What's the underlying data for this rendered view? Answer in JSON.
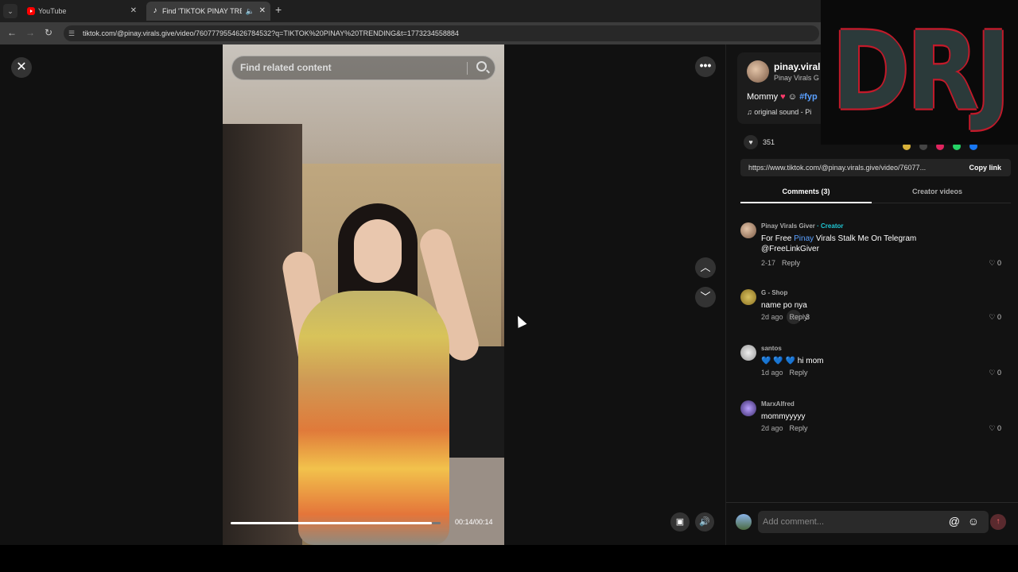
{
  "browser": {
    "tabs": [
      {
        "title": "YouTube",
        "icon": "youtube-icon"
      },
      {
        "title": "Find 'TIKTOK PINAY TRENDING'",
        "icon": "tiktok-icon",
        "active": true
      }
    ],
    "url": "tiktok.com/@pinay.virals.give/video/7607779554626784532?q=TIKTOK%20PINAY%20TRENDING&t=1773234558884"
  },
  "viewer": {
    "search_placeholder": "Find related content",
    "time": "00:14/00:14",
    "progress": 0.96
  },
  "author": {
    "username": "pinay.viral",
    "display_name": "Pinay Virals G",
    "caption_text": "Mommy",
    "caption_tag": "#fyp",
    "sound": "original sound - Pi"
  },
  "stats": {
    "likes": "351",
    "comments": "3"
  },
  "share": {
    "link": "https://www.tiktok.com/@pinay.virals.give/video/76077...",
    "copy_label": "Copy link"
  },
  "tabs": {
    "comments": "Comments (3)",
    "creator": "Creator videos"
  },
  "comments": [
    {
      "name": "Pinay Virals Giver",
      "creator": "· Creator",
      "text_pre": "For Free ",
      "text_hl": "Pinay",
      "text_post": " Virals Stalk Me On Telegram @FreeLinkGiver",
      "date": "2-17",
      "reply": "Reply",
      "likes": "0"
    },
    {
      "name": "G - Shop",
      "text": "name po nya",
      "date": "2d ago",
      "reply": "Reply",
      "likes": "0"
    },
    {
      "name": "santos",
      "text": "💙 💙 💙  hi mom",
      "date": "1d ago",
      "reply": "Reply",
      "likes": "0"
    },
    {
      "name": "MarxAlfred",
      "text": "mommyyyyy",
      "date": "2d ago",
      "reply": "Reply",
      "likes": "0"
    }
  ],
  "comment_input": {
    "placeholder": "Add comment..."
  },
  "overlay": {
    "logo_text": "DRJ"
  },
  "colors": {
    "accent": "#fe2c55",
    "creator_tag": "#1fc7d4",
    "hashtag": "#5aa0ff"
  }
}
